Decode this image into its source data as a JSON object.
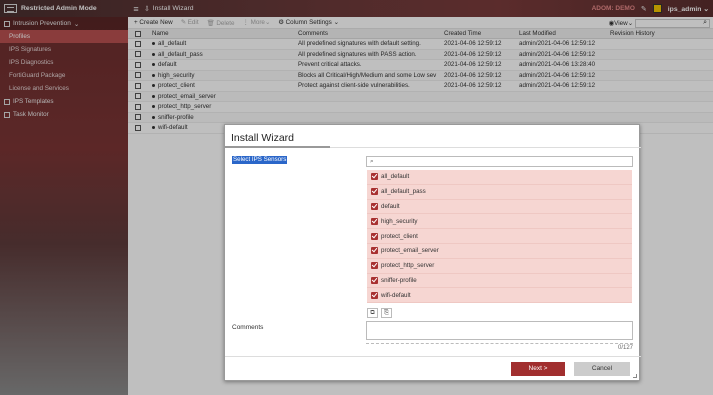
{
  "topbar": {
    "mode": "Restricted Admin Mode",
    "title": "Install Wizard",
    "adom": "ADOM: DEMO",
    "user": "ips_admin"
  },
  "sidebar": {
    "section": "Intrusion Prevention",
    "items": [
      "Profiles",
      "IPS Signatures",
      "IPS Diagnostics",
      "FortiGuard Package",
      "License and Services"
    ],
    "groups": [
      "IPS Templates",
      "Task Monitor"
    ]
  },
  "toolbar": {
    "create": "+ Create New",
    "edit": "Edit",
    "delete": "Delete",
    "more": "More",
    "column_settings": "Column Settings",
    "view": "View"
  },
  "table": {
    "headers": [
      "Name",
      "Comments",
      "Created Time",
      "Last Modified",
      "Revision History"
    ],
    "rows": [
      {
        "name": "all_default",
        "comments": "All predefined signatures with default setting.",
        "created": "2021-04-06 12:59:12",
        "modified": "admin/2021-04-06 12:59:12"
      },
      {
        "name": "all_default_pass",
        "comments": "All predefined signatures with PASS action.",
        "created": "2021-04-06 12:59:12",
        "modified": "admin/2021-04-06 12:59:12"
      },
      {
        "name": "default",
        "comments": "Prevent critical attacks.",
        "created": "2021-04-06 12:59:12",
        "modified": "admin/2021-04-06 13:28:40"
      },
      {
        "name": "high_security",
        "comments": "Blocks all Critical/High/Medium and some Low sev",
        "created": "2021-04-06 12:59:12",
        "modified": "admin/2021-04-06 12:59:12"
      },
      {
        "name": "protect_client",
        "comments": "Protect against client-side vulnerabilities.",
        "created": "2021-04-06 12:59:12",
        "modified": "admin/2021-04-06 12:59:12"
      },
      {
        "name": "protect_email_server",
        "comments": "",
        "created": "",
        "modified": ""
      },
      {
        "name": "protect_http_server",
        "comments": "",
        "created": "",
        "modified": ""
      },
      {
        "name": "sniffer-profile",
        "comments": "",
        "created": "",
        "modified": ""
      },
      {
        "name": "wifi-default",
        "comments": "",
        "created": "",
        "modified": ""
      }
    ]
  },
  "dialog": {
    "title": "Install Wizard",
    "sensors_label": "Select IPS Sensors",
    "sensors": [
      "all_default",
      "all_default_pass",
      "default",
      "high_security",
      "protect_client",
      "protect_email_server",
      "protect_http_server",
      "sniffer-profile",
      "wifi-default"
    ],
    "comments_label": "Comments",
    "counter": "0/127",
    "next": "Next >",
    "cancel": "Cancel"
  },
  "colors": {
    "accent": "#a12f2f",
    "selection_bg": "#f6d6d2",
    "active_nav": "#b95050",
    "highlight": "#2a66c9"
  }
}
